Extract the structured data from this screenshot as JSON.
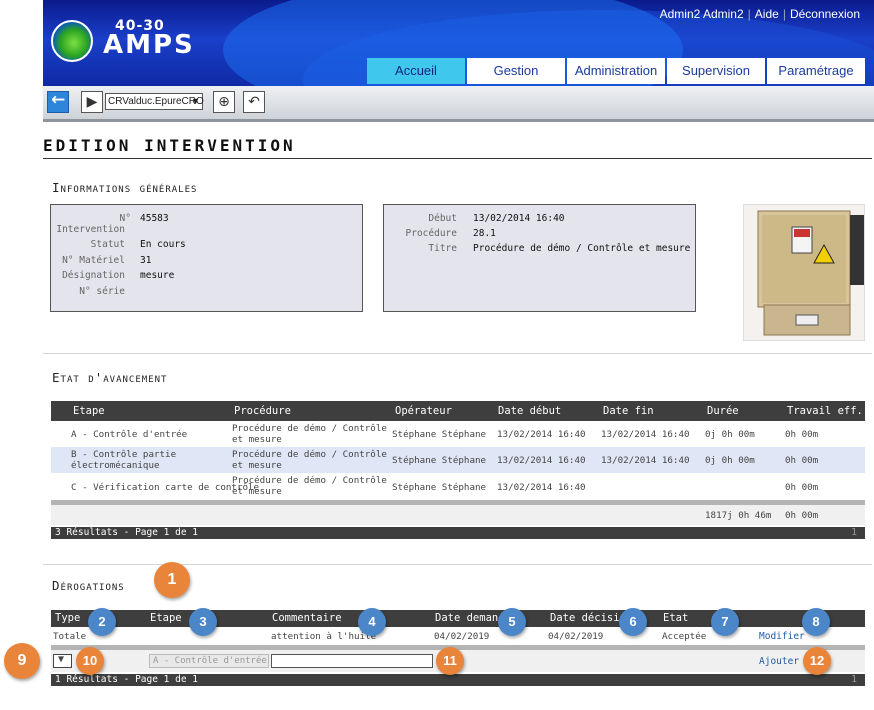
{
  "header": {
    "logo_top": "40-30",
    "logo_main": "AMPS",
    "user_name": "Admin2 Admin2",
    "help_link": "Aide",
    "logout_link": "Déconnexion",
    "nav_tabs": [
      "Accueil",
      "Gestion",
      "Administration",
      "Supervision",
      "Paramétrage"
    ],
    "active_tab": "Accueil"
  },
  "toolbar": {
    "select_value": "CRValduc.EpureCRO"
  },
  "page": {
    "title": "Edition intervention"
  },
  "general_info": {
    "section_title": "Informations générales",
    "left_box": [
      {
        "label": "N°",
        "value": "45583"
      },
      {
        "label": "Intervention",
        "value": ""
      },
      {
        "label": "Statut",
        "value": "En cours"
      },
      {
        "label": "N° Matériel",
        "value": "31"
      },
      {
        "label": "Désignation",
        "value": "mesure"
      },
      {
        "label": "N° série",
        "value": ""
      }
    ],
    "right_box": [
      {
        "label": "Début",
        "value": "13/02/2014 16:40"
      },
      {
        "label": "Procédure",
        "value": "28.1"
      },
      {
        "label": "Titre",
        "value": "Procédure de démo / Contrôle et mesure"
      }
    ]
  },
  "progress": {
    "section_title": "Etat d'avancement",
    "columns": [
      "Etape",
      "Procédure",
      "Opérateur",
      "Date début",
      "Date fin",
      "Durée",
      "Travail eff."
    ],
    "rows": [
      [
        "A - Contrôle d'entrée",
        "Procédure de démo / Contrôle et mesure",
        "Stéphane Stéphane",
        "13/02/2014 16:40",
        "13/02/2014 16:40",
        "0j 0h 00m",
        "0h 00m"
      ],
      [
        "B - Contrôle partie électromécanique",
        "Procédure de démo / Contrôle et mesure",
        "Stéphane Stéphane",
        "13/02/2014 16:40",
        "13/02/2014 16:40",
        "0j 0h 00m",
        "0h 00m"
      ],
      [
        "C - Vérification carte de contrôle",
        "Procédure de démo / Contrôle et mesure",
        "Stéphane Stéphane",
        "13/02/2014 16:40",
        "",
        "",
        "0h 00m"
      ]
    ],
    "totals": {
      "duration": "1817j 0h 46m",
      "work": "0h 00m"
    },
    "footer": "3 Résultats - Page 1 de 1",
    "page_number": "1"
  },
  "derogations": {
    "section_title": "Dérogations",
    "columns": [
      "Type",
      "Etape",
      "Commentaire",
      "Date deman",
      "Date décision",
      "Etat",
      ""
    ],
    "rows": [
      {
        "type": "Totale",
        "etape": "",
        "commentaire": "attention à l'huile",
        "date_demande": "04/02/2019",
        "date_decision": "04/02/2019",
        "etat": "Acceptée",
        "action": "Modifier"
      }
    ],
    "new_row": {
      "etape_placeholder": "A - Contrôle d'entrée",
      "commentaire_value": "",
      "action": "Ajouter"
    },
    "footer": "1 Résultats - Page 1 de 1",
    "page_number": "1"
  },
  "callouts": [
    "1",
    "2",
    "3",
    "4",
    "5",
    "6",
    "7",
    "8",
    "9",
    "10",
    "11",
    "12"
  ],
  "colors": {
    "header_blue": "#1a3fc9",
    "active_tab": "#3fc7ee",
    "callout_blue": "#4a86c8",
    "callout_orange": "#e8853b",
    "grid_header": "#3e3e3e",
    "selected_row": "#dfe6f5"
  }
}
